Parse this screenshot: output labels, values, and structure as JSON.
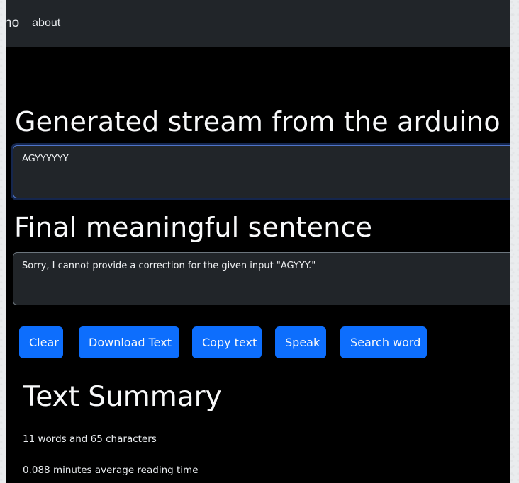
{
  "navbar": {
    "brand": "ho",
    "links": [
      {
        "label": "about"
      }
    ]
  },
  "stream": {
    "heading": "Generated stream from the arduino",
    "value": "AGYYYYYY"
  },
  "final": {
    "heading": "Final meaningful sentence",
    "value": "Sorry, I cannot provide a correction for the given input \"AGYYY.\""
  },
  "buttons": {
    "clear": "Clear",
    "download": "Download Text",
    "copy": "Copy text",
    "speak": "Speak",
    "search": "Search word"
  },
  "summary": {
    "heading": "Text Summary",
    "counts": "11 words and 65 characters",
    "reading_time": "0.088 minutes average reading time"
  },
  "colors": {
    "primary": "#0d6efd",
    "navbar_bg": "#212529",
    "page_bg": "#000000",
    "textarea_bg": "#212529",
    "focus_ring": "#4f74c8"
  }
}
